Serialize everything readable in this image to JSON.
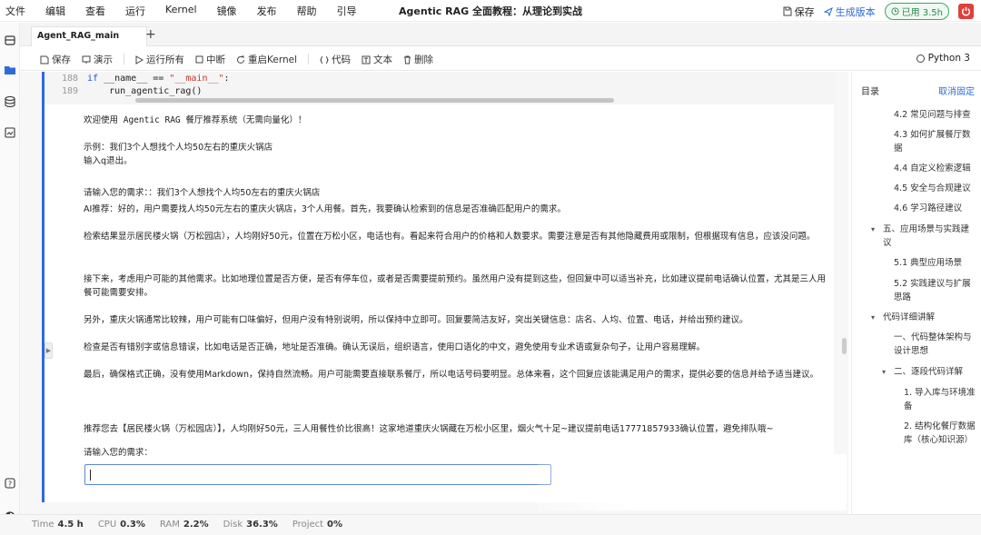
{
  "menu": {
    "items": [
      "文件",
      "编辑",
      "查看",
      "运行",
      "Kernel",
      "镜像",
      "发布",
      "帮助",
      "引导"
    ]
  },
  "window_title": "Agentic RAG 全面教程：从理论到实战",
  "topbar": {
    "save": "保存",
    "generate_version": "生成版本",
    "uptime": "已用 3.5h"
  },
  "tab": {
    "name": "Agent_RAG_main",
    "add": "+"
  },
  "toolbar": {
    "save": "保存",
    "present": "演示",
    "run_all": "运行所有",
    "interrupt": "中断",
    "restart": "重启Kernel",
    "code": "代码",
    "text": "文本",
    "delete": "删除",
    "kernel": "Python 3"
  },
  "code_lines": [
    {
      "num": "188",
      "kw": "if",
      "a": " __name__ == ",
      "str": "\"__main__\"",
      "b": ":"
    },
    {
      "num": "189",
      "text": "    run_agentic_rag()"
    }
  ],
  "output": {
    "welcome": "欢迎使用 Agentic RAG 餐厅推荐系统（无需向量化）！",
    "example": "示例：我们3个人想找个人均50左右的重庆火锅店",
    "quit_hint": "输入q退出。",
    "prompt_line": "请输入您的需求：：我们3个人想找个人均50左右的重庆火锅店",
    "ai_p1": "AI推荐：好的，用户需要找人均50元左右的重庆火锅店，3个人用餐。首先，我要确认检索到的信息是否准确匹配用户的需求。",
    "ai_p2": "检索结果显示居民楼火锅（万松园店），人均刚好50元，位置在万松小区，电话也有。看起来符合用户的价格和人数要求。需要注意是否有其他隐藏费用或限制，但根据现有信息，应该没问题。",
    "ai_p3": "接下来，考虑用户可能的其他需求。比如地理位置是否方便，是否有停车位，或者是否需要提前预约。虽然用户没有提到这些，但回复中可以适当补充，比如建议提前电话确认位置，尤其是三人用餐可能需要安排。",
    "ai_p4": "另外，重庆火锅通常比较辣，用户可能有口味偏好，但用户没有特别说明，所以保持中立即可。回复要简洁友好，突出关键信息：店名、人均、位置、电话，并给出预约建议。",
    "ai_p5": "检查是否有错别字或信息错误，比如电话是否正确，地址是否准确。确认无误后，组织语言，使用口语化的中文，避免使用专业术语或复杂句子，让用户容易理解。",
    "ai_p6": "最后，确保格式正确，没有使用Markdown，保持自然流畅。用户可能需要直接联系餐厅，所以电话号码要明显。总体来看，这个回复应该能满足用户的需求，提供必要的信息并给予适当建议。",
    "recommendation": "推荐您去【居民楼火锅（万松园店）】，人均刚好50元，三人用餐性价比很高！这家地道重庆火锅藏在万松小区里，烟火气十足~建议提前电话17771857933确认位置，避免排队哦~",
    "input_prompt": "请输入您的需求："
  },
  "toc": {
    "title": "目录",
    "unpin": "取消固定",
    "items": [
      "4.2 常见问题与排查",
      "4.3 如何扩展餐厅数据",
      "4.4 自定义检索逻辑",
      "4.5 安全与合规建议",
      "4.6 学习路径建议",
      "五、应用场景与实践建议",
      "5.1 典型应用场景",
      "5.2 实践建议与扩展思路",
      "代码详细讲解",
      "一、代码整体架构与设计思想",
      "二、逐段代码详解",
      "1. 导入库与环境准备",
      "2. 结构化餐厅数据库（核心知识源）"
    ]
  },
  "status": {
    "time_label": "Time",
    "time": "4.5 h",
    "cpu_label": "CPU",
    "cpu": "0.3%",
    "ram_label": "RAM",
    "ram": "2.2%",
    "disk_label": "Disk",
    "disk": "36.3%",
    "project_label": "Project",
    "project": "0%"
  }
}
